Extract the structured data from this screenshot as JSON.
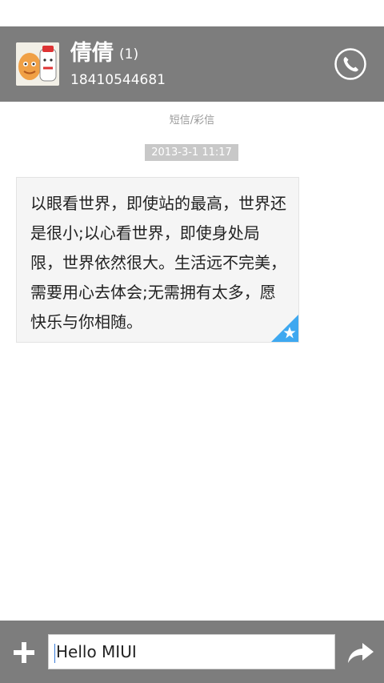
{
  "header": {
    "contact_name": "倩倩",
    "unread_count": "(1)",
    "phone_number": "18410544681"
  },
  "conversation": {
    "message_type": "短信/彩信",
    "timestamp": "2013-3-1 11:17",
    "messages": [
      {
        "text": "以眼看世界，即使站的最高，世界还是很小;以心看世界，即使身处局限，世界依然很大。生活远不完美，需要用心去体会;无需拥有太多，愿快乐与你相随。",
        "favorited": true
      }
    ]
  },
  "composer": {
    "input_value": "Hello MIUI"
  },
  "colors": {
    "header_bg": "#7d7d7d",
    "bubble_bg": "#f5f5f5",
    "accent": "#3ea8f0"
  },
  "icons": [
    "avatar",
    "phone-icon",
    "star-icon",
    "plus-icon",
    "send-arrow-icon"
  ]
}
